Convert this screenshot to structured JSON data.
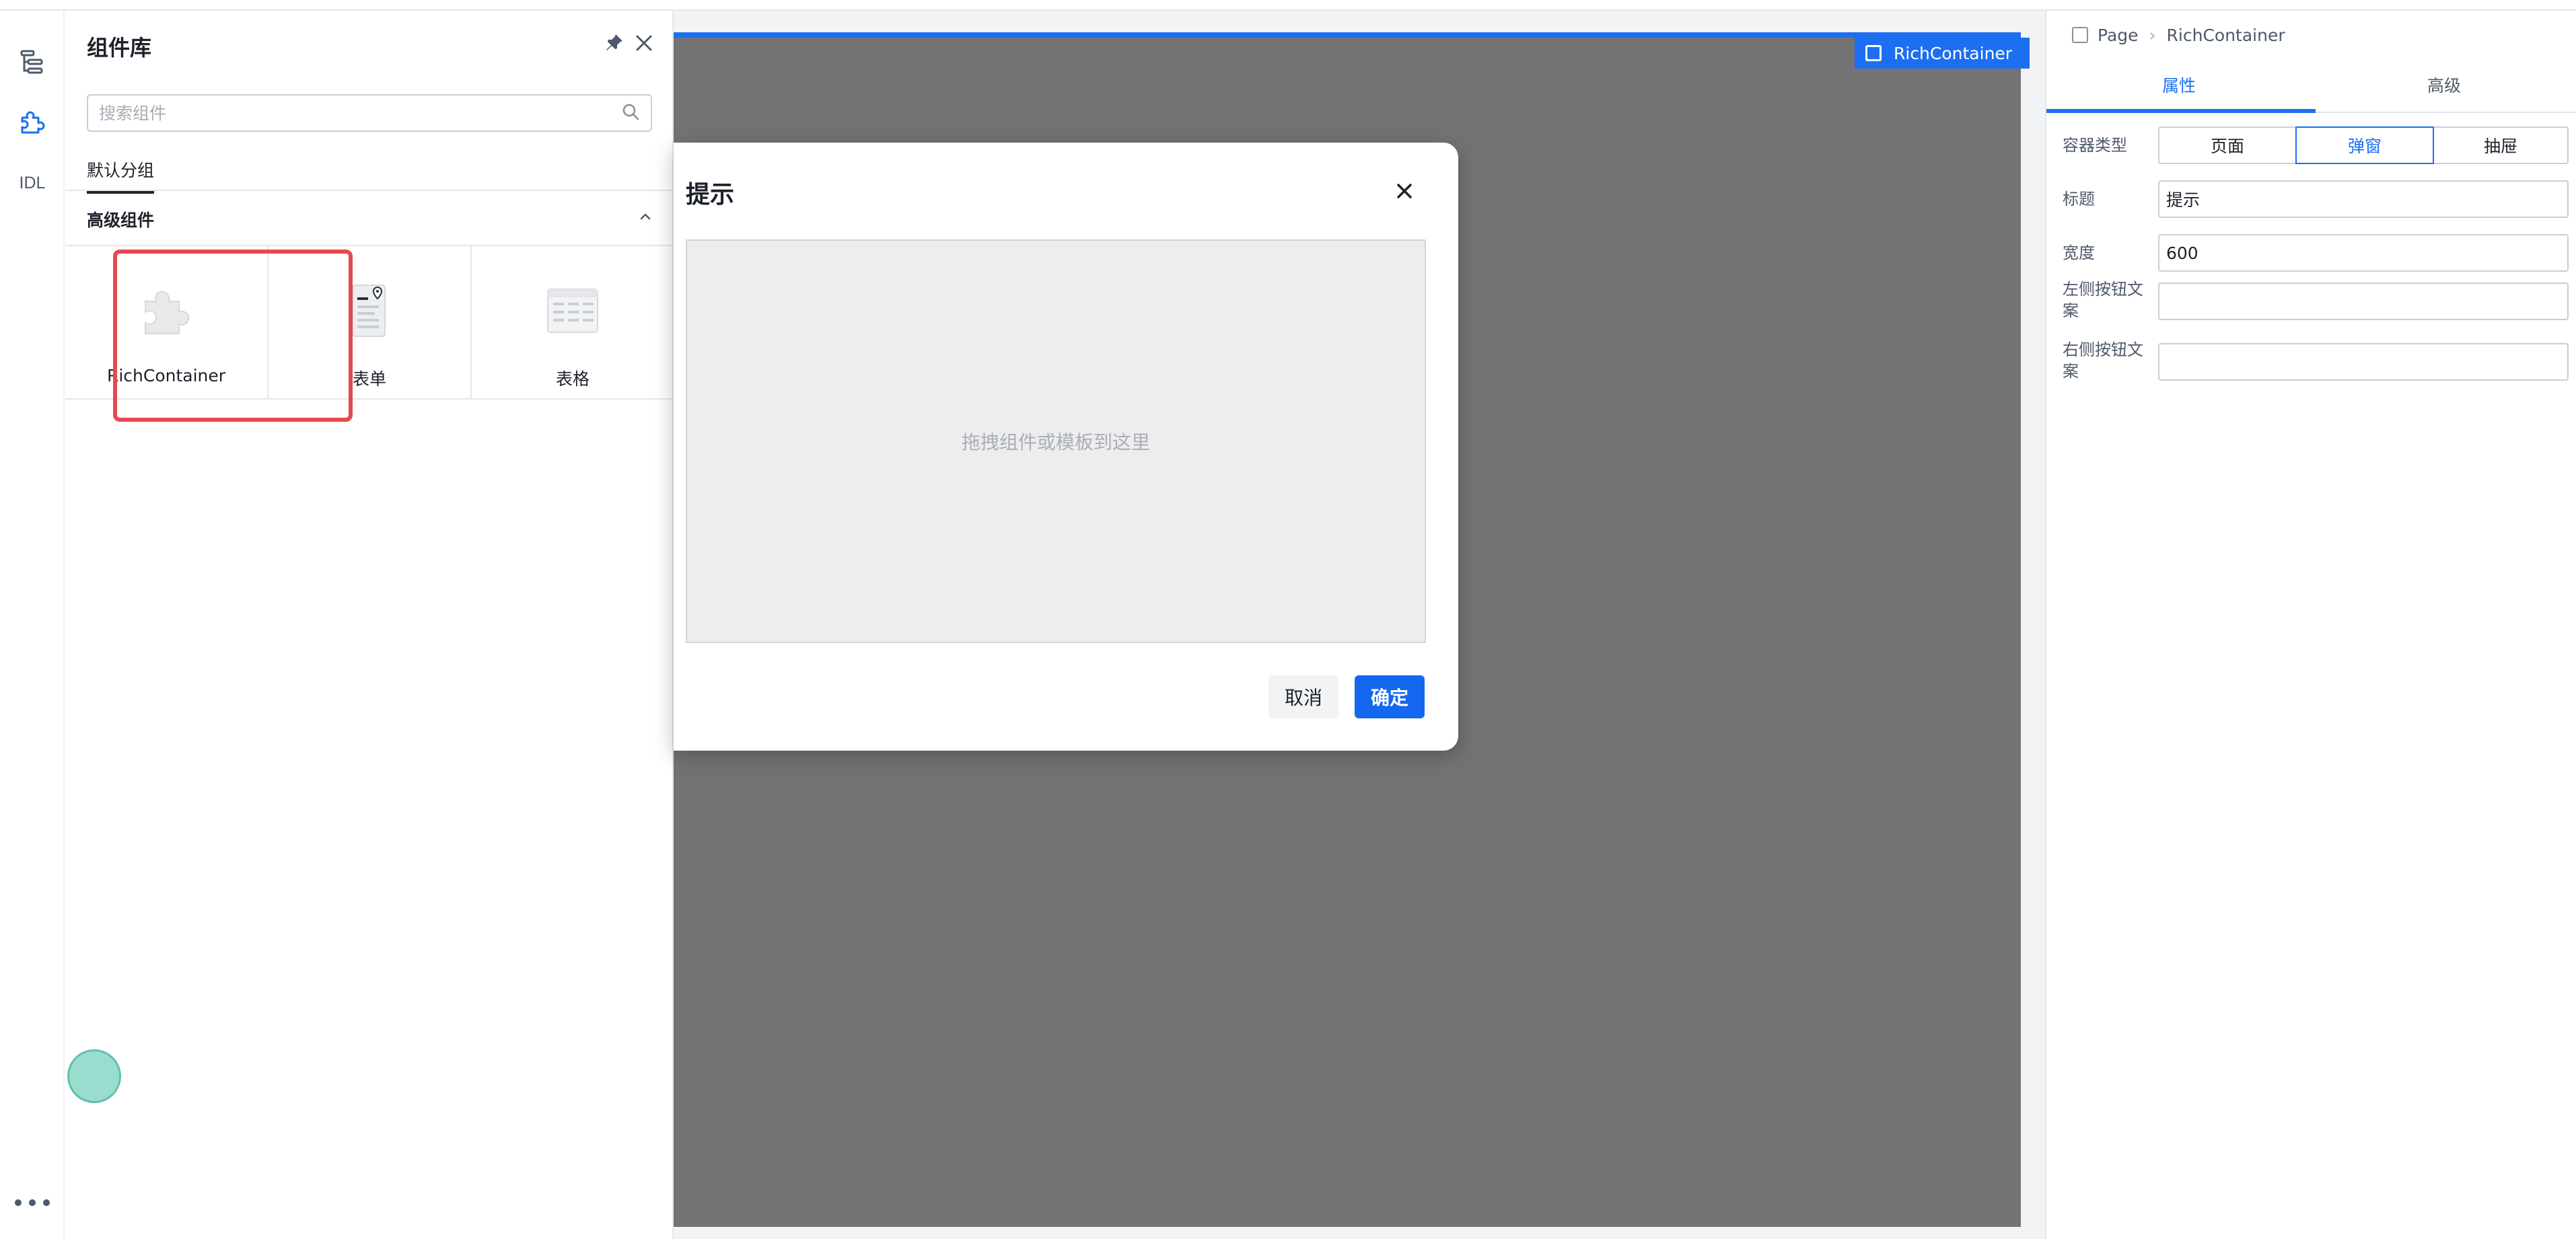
{
  "rail": {
    "items": [
      {
        "name": "outline",
        "icon": "outline-tree-icon"
      },
      {
        "name": "components",
        "icon": "puzzle-icon"
      },
      {
        "name": "idl",
        "label": "IDL"
      }
    ]
  },
  "library": {
    "title": "组件库",
    "search_placeholder": "搜索组件",
    "tab": "默认分组",
    "group_title": "高级组件",
    "components": [
      {
        "label": "RichContainer",
        "icon": "puzzle-icon"
      },
      {
        "label": "表单",
        "icon": "form-icon"
      },
      {
        "label": "表格",
        "icon": "table-icon"
      }
    ]
  },
  "canvas": {
    "selected_badge": "RichContainer"
  },
  "modal": {
    "title": "提示",
    "dropzone_text": "拖拽组件或模板到这里",
    "cancel_label": "取消",
    "ok_label": "确定"
  },
  "props": {
    "breadcrumb": [
      "Page",
      "RichContainer"
    ],
    "tabs": [
      "属性",
      "高级"
    ],
    "container_type_label": "容器类型",
    "container_types": [
      "页面",
      "弹窗",
      "抽屉"
    ],
    "selected_container_type": "弹窗",
    "title_label": "标题",
    "title_value": "提示",
    "width_label": "宽度",
    "width_value": "600",
    "left_btn_label": "左侧按钮文案",
    "left_btn_value": "",
    "right_btn_label": "右侧按钮文案",
    "right_btn_value": ""
  },
  "colors": {
    "accent": "#1d6ff2",
    "highlight": "#e5484d",
    "canvas": "#737374"
  }
}
